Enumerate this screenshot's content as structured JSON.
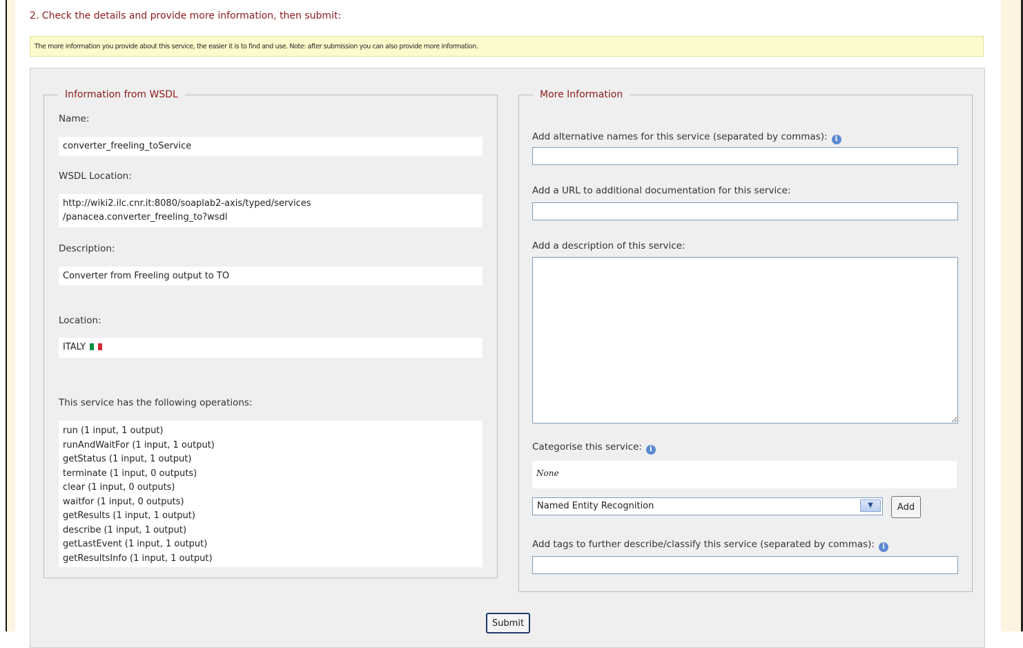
{
  "step_heading": "2. Check the details and provide more information, then submit:",
  "note": "The more information you provide about this service, the easier it is to find and use. Note: after submission you can also provide more information.",
  "wsdl_info": {
    "legend": "Information from WSDL",
    "name_label": "Name:",
    "name_value": "converter_freeling_toService",
    "wsdl_location_label": "WSDL Location:",
    "wsdl_location_line1": "http://wiki2.ilc.cnr.it:8080/soaplab2-axis/typed/services",
    "wsdl_location_line2": "/panacea.converter_freeling_to?wsdl",
    "description_label": "Description:",
    "description_value": "Converter from Freeling output to TO",
    "location_label": "Location:",
    "location_value": "ITALY",
    "location_flag_colors": [
      "#009246",
      "#ffffff",
      "#ce2b37"
    ],
    "operations_label": "This service has the following operations:",
    "operations": [
      "run (1 input, 1 output)",
      "runAndWaitFor (1 input, 1 output)",
      "getStatus (1 input, 1 output)",
      "terminate (1 input, 0 outputs)",
      "clear (1 input, 0 outputs)",
      "waitfor (1 input, 0 outputs)",
      "getResults (1 input, 1 output)",
      "describe (1 input, 1 output)",
      "getLastEvent (1 input, 1 output)",
      "getResultsInfo (1 input, 1 output)"
    ]
  },
  "more_info": {
    "legend": "More Information",
    "alt_names_label": "Add alternative names for this service (separated by commas):",
    "alt_names_value": "",
    "doc_url_label": "Add a URL to additional documentation for this service:",
    "doc_url_value": "",
    "description_label": "Add a description of this service:",
    "description_value": "",
    "categorise_label": "Categorise this service:",
    "categories_value": "None",
    "category_select_value": "Named Entity Recognition",
    "add_button": "Add",
    "tags_label": "Add tags to further describe/classify this service (separated by commas):",
    "tags_value": ""
  },
  "submit_button": "Submit",
  "icons": {
    "info": "info-icon",
    "flag": "italy-flag-icon",
    "dropdown": "chevron-down-icon"
  }
}
